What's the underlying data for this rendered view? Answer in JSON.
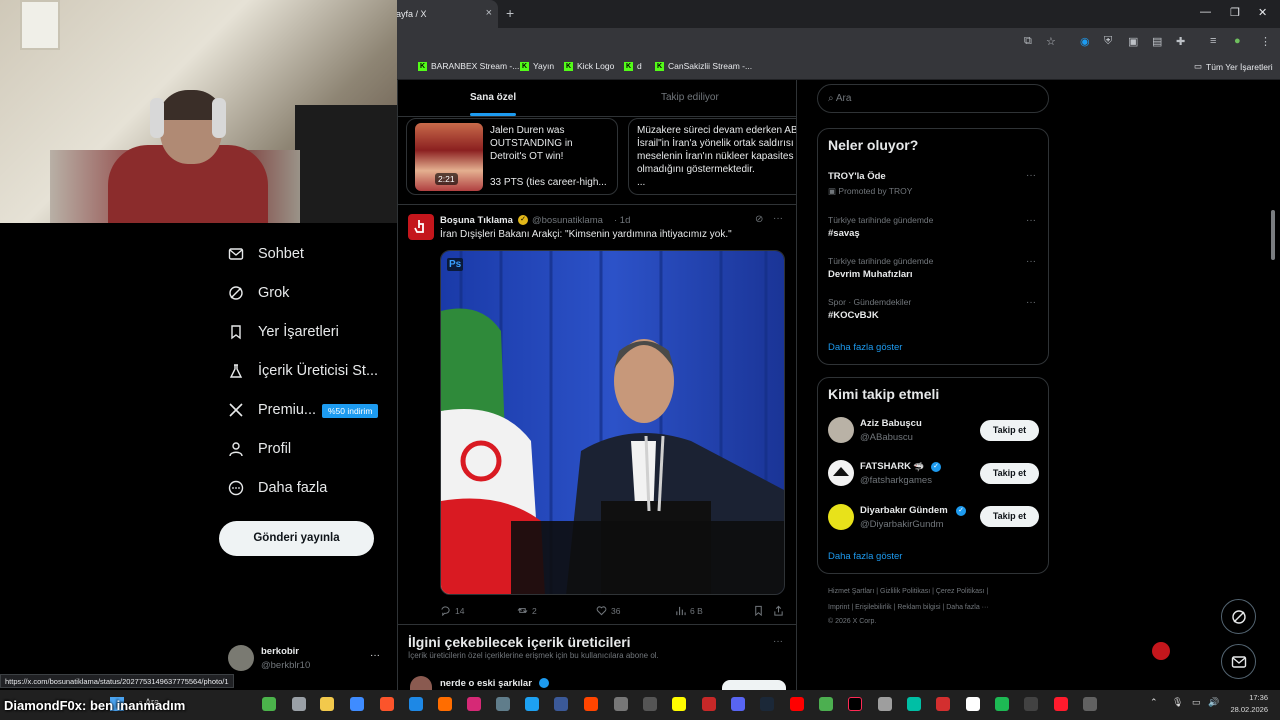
{
  "browser": {
    "tab_title": "ayfa / X",
    "tab_close": "×",
    "new_tab": "+",
    "bookmarks": [
      "BARANBEX Stream -...",
      "Yayın",
      "Kick Logo",
      "d",
      "CanSakizlii Stream -..."
    ],
    "all_bookmarks": "Tüm Yer İşaretleri"
  },
  "nav": {
    "items": [
      {
        "label": "Sohbet"
      },
      {
        "label": "Grok"
      },
      {
        "label": "Yer İşaretleri"
      },
      {
        "label": "İçerik Üreticisi St..."
      },
      {
        "label": "Premiu..."
      },
      {
        "label": "Profil"
      },
      {
        "label": "Daha fazla"
      }
    ],
    "premium_badge": "%50 indirim",
    "post_button": "Gönderi yayınla",
    "account_name": "berkobir",
    "account_handle": "@berkblr10",
    "account_more": "···"
  },
  "feed": {
    "tabs": [
      "Sana özel",
      "Takip ediliyor"
    ],
    "card1": {
      "line1": "Jalen Duren was",
      "line2": "OUTSTANDING in",
      "line3": "Detroit's OT win!",
      "line4": "33 PTS (ties career-high...",
      "duration": "2:21"
    },
    "card2": {
      "line1": "Müzakere süreci devam ederken AB",
      "line2": "İsrail\"in İran'a yönelik ortak saldırısı",
      "line3": "meselenin İran'ın nükleer kapasites",
      "line4": "olmadığını göstermektedir.",
      "line5": "..."
    },
    "tweet": {
      "author": "Boşuna Tıklama",
      "handle": "@bosunatiklama",
      "time": "· 1d",
      "text": "İran Dışişleri Bakanı Arakçi: \"Kimsenin yardımına ihtiyacımız yok.\"",
      "ps_badge": "Ps",
      "replies": "14",
      "reposts": "2",
      "likes": "36",
      "views": "6 B"
    },
    "creators_title": "İlgini çekebilecek içerik üreticileri",
    "creators_sub": "İçerik üreticilerin özel içeriklerine erişmek için bu kullanıcılara abone ol.",
    "creator_name": "nerde o eski şarkılar",
    "more": "···"
  },
  "right": {
    "search_placeholder": "Ara",
    "whats_happening": "Neler oluyor?",
    "trends": [
      {
        "meta": "",
        "title": "TROY'la Öde",
        "sub": "Promoted by TROY"
      },
      {
        "meta": "Türkiye tarihinde gündemde",
        "title": "#savaş"
      },
      {
        "meta": "Türkiye tarihinde gündemde",
        "title": "Devrim Muhafızları"
      },
      {
        "meta": "Spor · Gündemdekiler",
        "title": "#KOCvBJK"
      }
    ],
    "show_more": "Daha fazla göster",
    "who_to_follow": "Kimi takip etmeli",
    "follows": [
      {
        "name": "Aziz Babuşcu",
        "handle": "@ABabuscu",
        "button": "Takip et"
      },
      {
        "name": "FATSHARK",
        "handle": "@fatsharkgames",
        "button": "Takip et"
      },
      {
        "name": "Diyarbakır Gündem",
        "handle": "@DiyarbakirGundm",
        "button": "Takip et"
      }
    ],
    "show_more2": "Daha fazla göster",
    "footer1": "Hizmet Şartları  |  Gizlilik Politikası  |  Çerez Politikası  |",
    "footer2": "Imprint  |  Erişilebilirlik  |  Reklam bilgisi  |  Daha fazla ···",
    "footer3": "© 2026 X Corp."
  },
  "status_url": "https://x.com/bosunatiklama/status/2027753149637775564/photo/1",
  "overlay_text": "DiamondF0x: ben inanmadım",
  "taskbar": {
    "time": "17:36",
    "date": "28.02.2026",
    "search": "Ara"
  },
  "colors": {
    "accent": "#1d9bf0",
    "bg": "#000000",
    "border": "#2f3336"
  }
}
